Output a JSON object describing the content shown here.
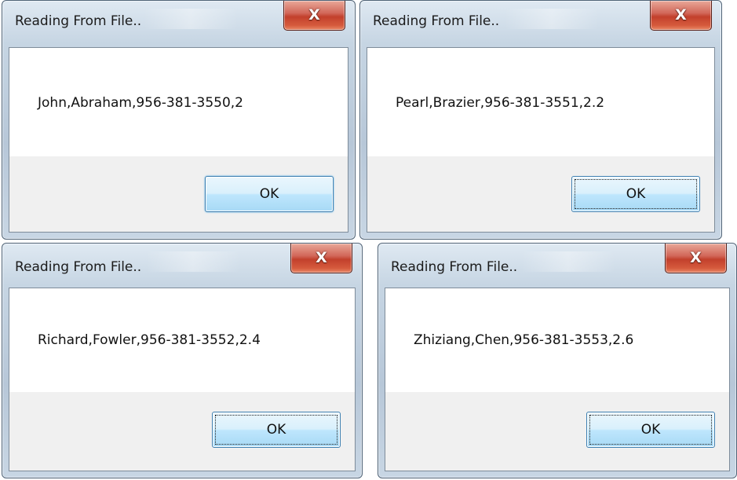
{
  "dialogs": [
    {
      "title": "Reading From File..",
      "message": "John,Abraham,956-381-3550,2",
      "ok_label": "OK",
      "close_glyph": "X"
    },
    {
      "title": "Reading From File..",
      "message": "Pearl,Brazier,956-381-3551,2.2",
      "ok_label": "OK",
      "close_glyph": "X"
    },
    {
      "title": "Reading From File..",
      "message": "Richard,Fowler,956-381-3552,2.4",
      "ok_label": "OK",
      "close_glyph": "X"
    },
    {
      "title": "Reading From File..",
      "message": "Zhiziang,Chen,956-381-3553,2.6",
      "ok_label": "OK",
      "close_glyph": "X"
    }
  ],
  "icons": {
    "close": "close-icon"
  },
  "colors": {
    "close_button": "#c2402c",
    "focus_button_border": "#3c7fb1",
    "button_area": "#f0f0f0"
  }
}
